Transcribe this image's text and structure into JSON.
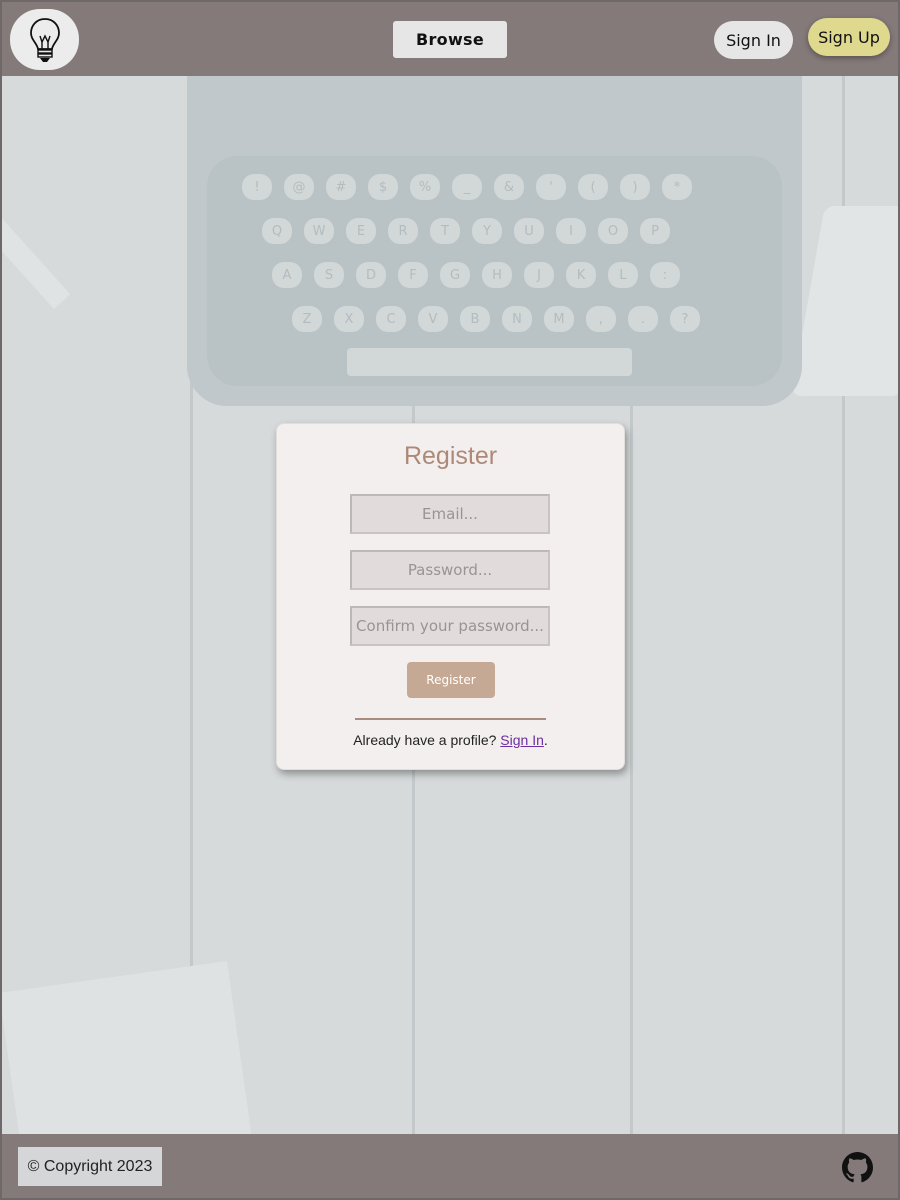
{
  "header": {
    "browse_label": "Browse",
    "signin_label": "Sign In",
    "signup_label": "Sign Up",
    "logo_icon": "lightbulb-icon"
  },
  "register_form": {
    "title": "Register",
    "email_placeholder": "Email...",
    "password_placeholder": "Password...",
    "confirm_placeholder": "Confirm your password...",
    "submit_label": "Register",
    "already_text": "Already have a profile?",
    "signin_link": "Sign In",
    "period": "."
  },
  "footer": {
    "copyright": "© Copyright 2023",
    "github_icon": "github-icon"
  },
  "colors": {
    "header_bg": "#857a7a",
    "signup_bg": "#dfd88f",
    "accent": "#ad8977",
    "button_bg": "#c6a995",
    "link": "#6b2fa0"
  },
  "background": {
    "keys": [
      "!",
      "@",
      "#",
      "$",
      "%",
      "_",
      "&",
      "'",
      "(",
      ")",
      "*",
      "Q",
      "W",
      "E",
      "R",
      "T",
      "Y",
      "U",
      "I",
      "O",
      "P",
      "A",
      "S",
      "D",
      "F",
      "G",
      "H",
      "J",
      "K",
      "L",
      ":",
      "Z",
      "X",
      "C",
      "V",
      "B",
      "N",
      "M",
      ",",
      ".",
      "?"
    ]
  }
}
